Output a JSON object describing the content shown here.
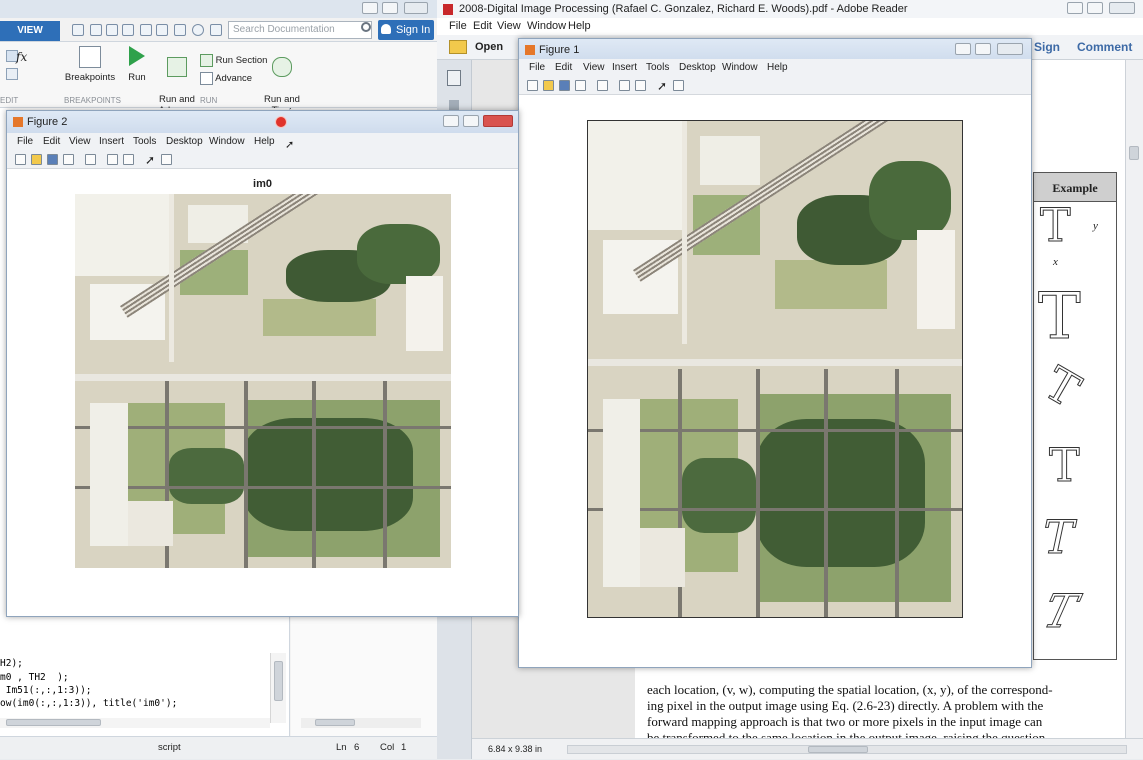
{
  "matlab": {
    "tab_view": "VIEW",
    "search_placeholder": "Search Documentation",
    "sign_in": "Sign In",
    "ribbon": {
      "breakpoints": "Breakpoints",
      "run": "Run",
      "run_and_advance": "Run and\nAdvance",
      "run_section": "Run Section",
      "advance": "Advance",
      "run_and_time": "Run and\nTime",
      "group_edit": "EDIT",
      "group_breakpoints": "BREAKPOINTS",
      "group_run": "RUN"
    },
    "code_lines": [
      "H2);",
      "m0 , TH2  );",
      " Im51(:,:,1:3));",
      "ow(im0(:,:,1:3)), title('im0');"
    ],
    "status": {
      "mode": "script",
      "ln_label": "Ln",
      "ln": "6",
      "col_label": "Col",
      "col": "1"
    }
  },
  "figure2": {
    "title": "Figure 2",
    "menu": [
      "File",
      "Edit",
      "View",
      "Insert",
      "Tools",
      "Desktop",
      "Window",
      "Help"
    ],
    "axes_title": "im0"
  },
  "adobe": {
    "title": "2008-Digital Image Processing (Rafael C. Gonzalez, Richard E. Woods).pdf - Adobe Reader",
    "menu": [
      "File",
      "Edit",
      "View",
      "Window",
      "Help"
    ],
    "open": "Open",
    "sign": "Sign",
    "comment": "Comment",
    "example_header": "Example",
    "body_text": [
      "each location, (v, w), computing the spatial location, (x, y), of the correspond-",
      "ing pixel in the output image using Eq. (2.6-23) directly. A problem with the",
      "forward mapping approach is that two or more pixels in the input image can",
      "be transformed to the same location in the output image, raising the question"
    ],
    "page_size": "6.84 x 9.38 in",
    "example_axis_y": "y",
    "example_axis_x": "x",
    "example_glyph": "T"
  },
  "figure1": {
    "title": "Figure 1",
    "menu": [
      "File",
      "Edit",
      "View",
      "Insert",
      "Tools",
      "Desktop",
      "Window",
      "Help"
    ]
  },
  "colors": {
    "matlab_blue": "#2e6fb8",
    "record_dot": "#e0332b",
    "figure_titlebar": "#dfe9f5"
  }
}
